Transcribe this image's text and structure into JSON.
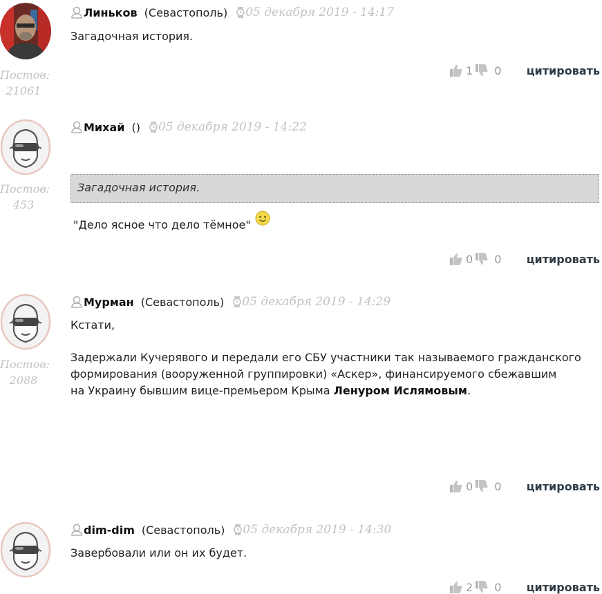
{
  "comments": [
    {
      "author": "Линьков",
      "city": "(Севастополь)",
      "date": "05 декабря 2019 - 14:17",
      "posts_label": "Постов:",
      "posts_count": "21061",
      "text": "Загадочная история.",
      "likes": "1",
      "dislikes": "0",
      "cite_label": "цитировать",
      "avatar": "photo-avatar"
    },
    {
      "author": "Михай",
      "city": "()",
      "date": "05 декабря 2019 - 14:22",
      "posts_label": "Постов:",
      "posts_count": "453",
      "quote": "Загадочная история.",
      "text": "\"Дело ясное что дело тёмное\"",
      "likes": "0",
      "dislikes": "0",
      "cite_label": "цитировать",
      "avatar": "goggles-avatar-icon"
    },
    {
      "author": "Мурман",
      "city": "(Севастополь)",
      "date": "05 декабря 2019 - 14:29",
      "posts_label": "Постов:",
      "posts_count": "2088",
      "text_line1": "Кстати,",
      "text_line2": "Задержали Кучерявого и передали его СБУ участники так называемого гражданского",
      "text_line3": "формирования (вооруженной группировки) «Аскер», финансируемого сбежавшим",
      "text_line4_prefix": "на Украину бывшим вице-премьером Крыма ",
      "text_line4_bold": "Ленуром Ислямовым",
      "text_line4_suffix": ".",
      "likes": "0",
      "dislikes": "0",
      "cite_label": "цитировать",
      "avatar": "goggles-avatar-icon"
    },
    {
      "author": "dim-dim",
      "city": "(Севастополь)",
      "date": "05 декабря 2019 - 14:30",
      "text": "Завербовали или он их будет.",
      "likes": "2",
      "dislikes": "0",
      "cite_label": "цитировать",
      "avatar": "goggles-avatar-icon"
    }
  ],
  "colors": {
    "meta_gray": "#c2c2c2",
    "cite": "#2f3b45",
    "quote_bg": "#d8d8d8",
    "smiley": "#f2d84a"
  }
}
